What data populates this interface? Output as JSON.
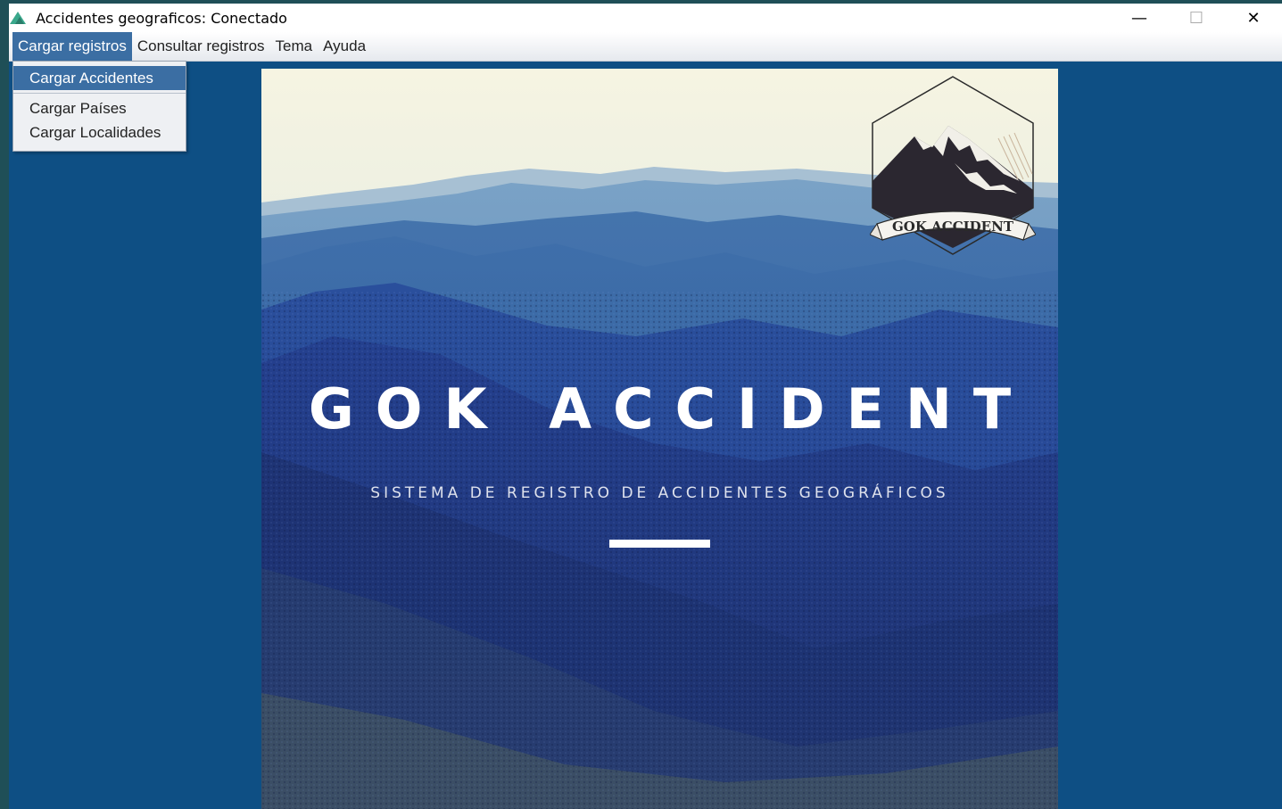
{
  "window": {
    "title": "Accidentes geograficos: Conectado",
    "controls": {
      "minimize": "—",
      "maximize": "☐",
      "close": "✕"
    }
  },
  "menubar": {
    "items": [
      {
        "label": "Cargar registros"
      },
      {
        "label": "Consultar registros"
      },
      {
        "label": "Tema"
      },
      {
        "label": "Ayuda"
      }
    ]
  },
  "dropdown": {
    "items": [
      {
        "label": "Cargar Accidentes"
      },
      {
        "label": "Cargar Países"
      },
      {
        "label": "Cargar Localidades"
      }
    ]
  },
  "banner": {
    "title": "GOK ACCIDENT",
    "subtitle": "SISTEMA DE REGISTRO DE ACCIDENTES GEOGRÁFICOS",
    "logo_text": "GOK ACCIDENT"
  },
  "colors": {
    "desktop_bg": "#1f4f57",
    "window_bg": "#0e4f84",
    "menu_highlight": "#3b6ea3"
  }
}
